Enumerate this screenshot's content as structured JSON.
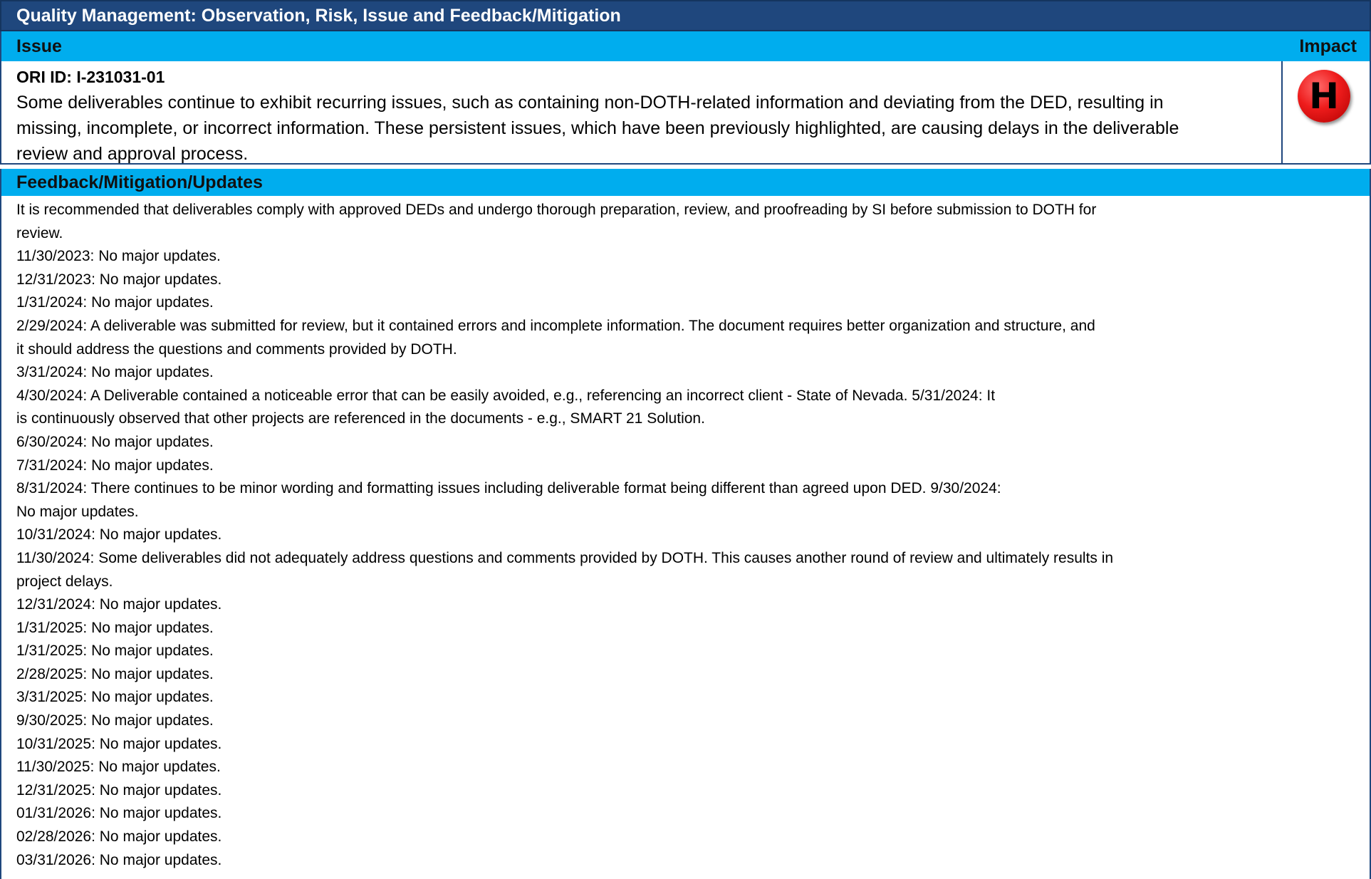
{
  "title": "Quality Management: Observation, Risk, Issue and Feedback/Mitigation",
  "issue_header": {
    "label": "Issue",
    "impact_label": "Impact"
  },
  "issue": {
    "ori_id": "ORI ID: I-231031-01",
    "description_lines": [
      "Some deliverables continue to exhibit recurring issues, such as containing non-DOTH-related information and deviating from the DED, resulting in",
      "missing, incomplete, or incorrect information. These persistent issues, which have been previously highlighted, are causing delays in the deliverable",
      "review and approval process."
    ],
    "impact": "H",
    "impact_color": "#ee1c1c"
  },
  "feedback": {
    "label": "Feedback/Mitigation/Updates",
    "lines": [
      "It is recommended that deliverables comply with approved DEDs and undergo thorough preparation, review, and proofreading by SI before submission to DOTH for",
      "review.",
      "11/30/2023: No major updates.",
      "12/31/2023: No major updates.",
      "1/31/2024: No major updates.",
      "2/29/2024: A deliverable was submitted for review, but it contained errors and incomplete information. The document requires better organization and structure, and",
      "it should address the questions and comments provided by DOTH.",
      "3/31/2024: No major updates.",
      "4/30/2024: A Deliverable contained a noticeable error that can be easily avoided, e.g., referencing an incorrect client - State of Nevada. 5/31/2024: It",
      "is continuously observed that other projects are referenced in the documents - e.g., SMART 21 Solution.",
      "6/30/2024: No major updates.",
      "7/31/2024: No major updates.",
      "8/31/2024: There continues to be minor wording and formatting issues including deliverable format being different than agreed upon DED. 9/30/2024:",
      "No major updates.",
      "10/31/2024: No major updates.",
      "11/30/2024: Some deliverables did not adequately address questions and comments provided by DOTH. This causes another round of review and ultimately results in",
      "project delays.",
      "12/31/2024: No major updates.",
      "1/31/2025: No major updates.",
      "1/31/2025: No major updates.",
      "2/28/2025: No major updates.",
      "3/31/2025: No major updates.",
      "9/30/2025: No major updates.",
      "10/31/2025: No major updates.",
      "11/30/2025: No major updates.",
      "12/31/2025: No major updates.",
      "01/31/2026: No major updates.",
      "02/28/2026: No major updates.",
      "03/31/2026: No major updates."
    ]
  },
  "colors": {
    "title_bg": "#1f477d",
    "band_bg": "#00adee",
    "border": "#1f477d"
  }
}
